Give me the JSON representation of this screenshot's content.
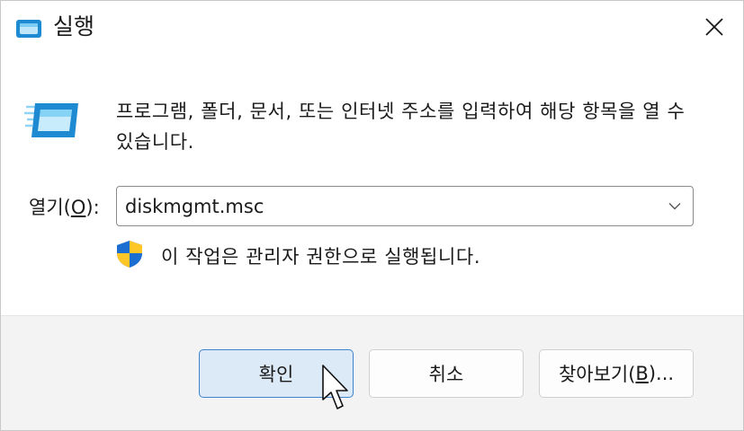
{
  "window": {
    "title": "실행"
  },
  "content": {
    "description": "프로그램, 폴더, 문서, 또는 인터넷 주소를 입력하여 해당 항목을 열 수 있습니다.",
    "open_label_prefix": "열기(",
    "open_label_accel": "O",
    "open_label_suffix": "):",
    "command_value": "diskmgmt.msc",
    "admin_note": "이 작업은 관리자 권한으로 실행됩니다."
  },
  "buttons": {
    "ok": "확인",
    "cancel": "취소",
    "browse_prefix": "찾아보기(",
    "browse_accel": "B",
    "browse_suffix": ")..."
  },
  "icons": {
    "title": "run-icon",
    "close": "close-icon",
    "main": "run-icon",
    "dropdown": "chevron-down-icon",
    "admin": "uac-shield-icon",
    "pointer": "mouse-cursor-icon"
  },
  "colors": {
    "accent": "#3f82cd",
    "primary_button_bg": "#dce9f6",
    "footer_bg": "#f3f3f3",
    "icon_blue": "#1e8ad2"
  }
}
